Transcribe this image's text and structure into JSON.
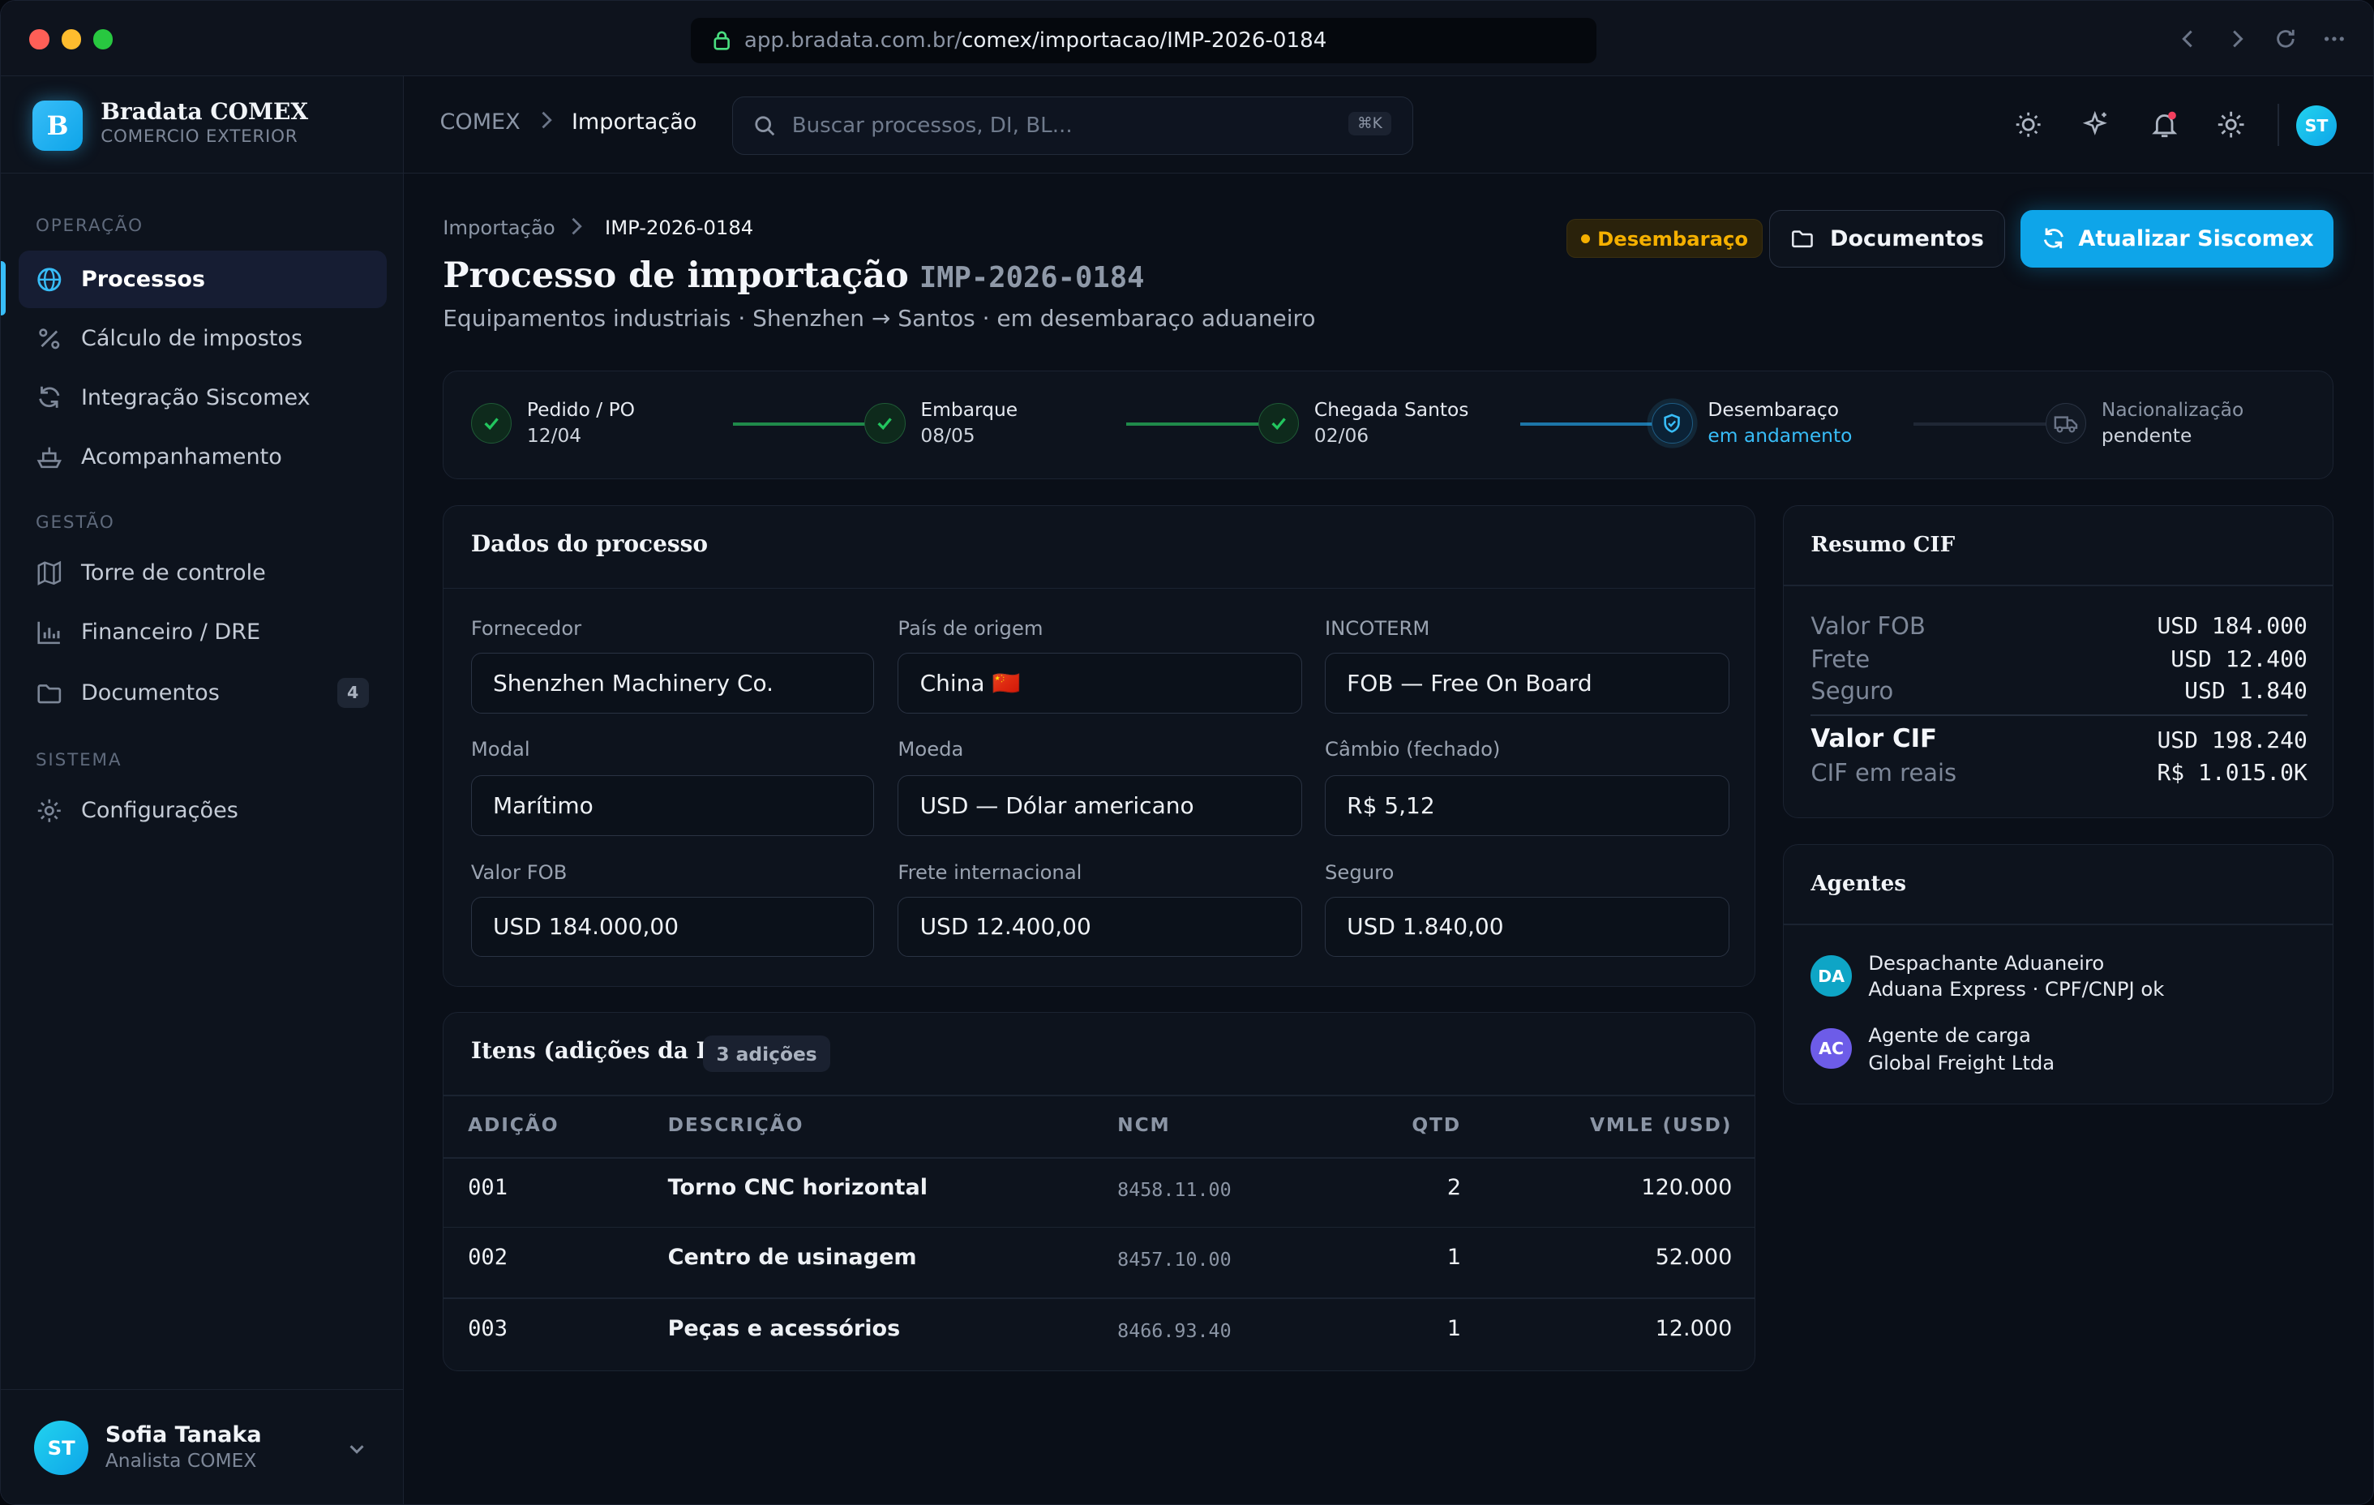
{
  "browser": {
    "url_host": "app.bradata.com.br/",
    "url_path": "comex/importacao/IMP-2026-0184"
  },
  "sidebar": {
    "brand_initial": "B",
    "brand_name": "Bradata COMEX",
    "brand_sub": "COMERCIO EXTERIOR",
    "sections": {
      "operacao": "OPERAÇÃO",
      "gestao": "GESTÃO",
      "sistema": "SISTEMA"
    },
    "items": [
      {
        "label": "Processos",
        "icon": "globe-icon",
        "active": true
      },
      {
        "label": "Cálculo de impostos",
        "icon": "percent-icon"
      },
      {
        "label": "Integração Siscomex",
        "icon": "sync-icon"
      },
      {
        "label": "Acompanhamento",
        "icon": "ship-icon"
      },
      {
        "label": "Torre de controle",
        "icon": "map-icon"
      },
      {
        "label": "Financeiro / DRE",
        "icon": "chart-icon"
      },
      {
        "label": "Documentos",
        "icon": "folder-icon",
        "badge": "4"
      },
      {
        "label": "Configurações",
        "icon": "gear-icon"
      }
    ],
    "user": {
      "initials": "ST",
      "name": "Sofia Tanaka",
      "role": "Analista COMEX"
    }
  },
  "topbar": {
    "breadcrumb_root": "COMEX",
    "breadcrumb_current": "Importação",
    "search_placeholder": "Buscar processos, DI, BL...",
    "search_shortcut": "⌘K",
    "user_initials": "ST"
  },
  "page": {
    "breadcrumb_root": "Importação",
    "breadcrumb_current": "IMP-2026-0184",
    "title": "Processo de importação",
    "process_id": "IMP-2026-0184",
    "subtitle": "Equipamentos industriais · Shenzhen → Santos · em desembaraço aduaneiro",
    "status_badge": "Desembaraço",
    "documents_button": "Documentos",
    "update_button": "Atualizar Siscomex"
  },
  "timeline": [
    {
      "title": "Pedido / PO",
      "sub": "12/04",
      "state": "done"
    },
    {
      "title": "Embarque",
      "sub": "08/05",
      "state": "done"
    },
    {
      "title": "Chegada Santos",
      "sub": "02/06",
      "state": "done"
    },
    {
      "title": "Desembaraço",
      "sub": "em andamento",
      "state": "current"
    },
    {
      "title": "Nacionalização",
      "sub": "pendente",
      "state": "pending"
    }
  ],
  "dados": {
    "title": "Dados do processo",
    "fields": [
      {
        "label": "Fornecedor",
        "value": "Shenzhen Machinery Co."
      },
      {
        "label": "País de origem",
        "value": "China 🇨🇳"
      },
      {
        "label": "INCOTERM",
        "value": "FOB — Free On Board"
      },
      {
        "label": "Modal",
        "value": "Marítimo"
      },
      {
        "label": "Moeda",
        "value": "USD — Dólar americano"
      },
      {
        "label": "Câmbio (fechado)",
        "value": "R$ 5,12"
      },
      {
        "label": "Valor FOB",
        "value": "USD 184.000,00"
      },
      {
        "label": "Frete internacional",
        "value": "USD 12.400,00"
      },
      {
        "label": "Seguro",
        "value": "USD 1.840,00"
      }
    ]
  },
  "itens": {
    "title": "Itens (adições da DI)",
    "badge": "3 adições",
    "headers": [
      "ADIÇÃO",
      "DESCRIÇÃO",
      "NCM",
      "QTD",
      "VMLE (USD)"
    ],
    "rows": [
      {
        "adicao": "001",
        "descricao": "Torno CNC horizontal",
        "ncm": "8458.11.00",
        "qtd": "2",
        "vmle": "120.000"
      },
      {
        "adicao": "002",
        "descricao": "Centro de usinagem",
        "ncm": "8457.10.00",
        "qtd": "1",
        "vmle": "52.000"
      },
      {
        "adicao": "003",
        "descricao": "Peças e acessórios",
        "ncm": "8466.93.40",
        "qtd": "1",
        "vmle": "12.000"
      }
    ]
  },
  "cif": {
    "title": "Resumo CIF",
    "rows": [
      {
        "label": "Valor FOB",
        "value": "USD 184.000"
      },
      {
        "label": "Frete",
        "value": "USD 12.400"
      },
      {
        "label": "Seguro",
        "value": "USD 1.840"
      }
    ],
    "total_label": "Valor CIF",
    "total_value": "USD 198.240",
    "reais_label": "CIF em reais",
    "reais_value": "R$ 1.015.0K"
  },
  "agentes": {
    "title": "Agentes",
    "list": [
      {
        "initials": "DA",
        "role": "Despachante Aduaneiro",
        "detail": "Aduana Express · CPF/CNPJ ok",
        "color": "#0ea5c6"
      },
      {
        "initials": "AC",
        "role": "Agente de carga",
        "detail": "Global Freight Ltda",
        "color": "#6d5ce8"
      }
    ]
  },
  "colors": {
    "accent": "#38bdf8",
    "success": "#22c55e",
    "warning": "#f5b000"
  }
}
